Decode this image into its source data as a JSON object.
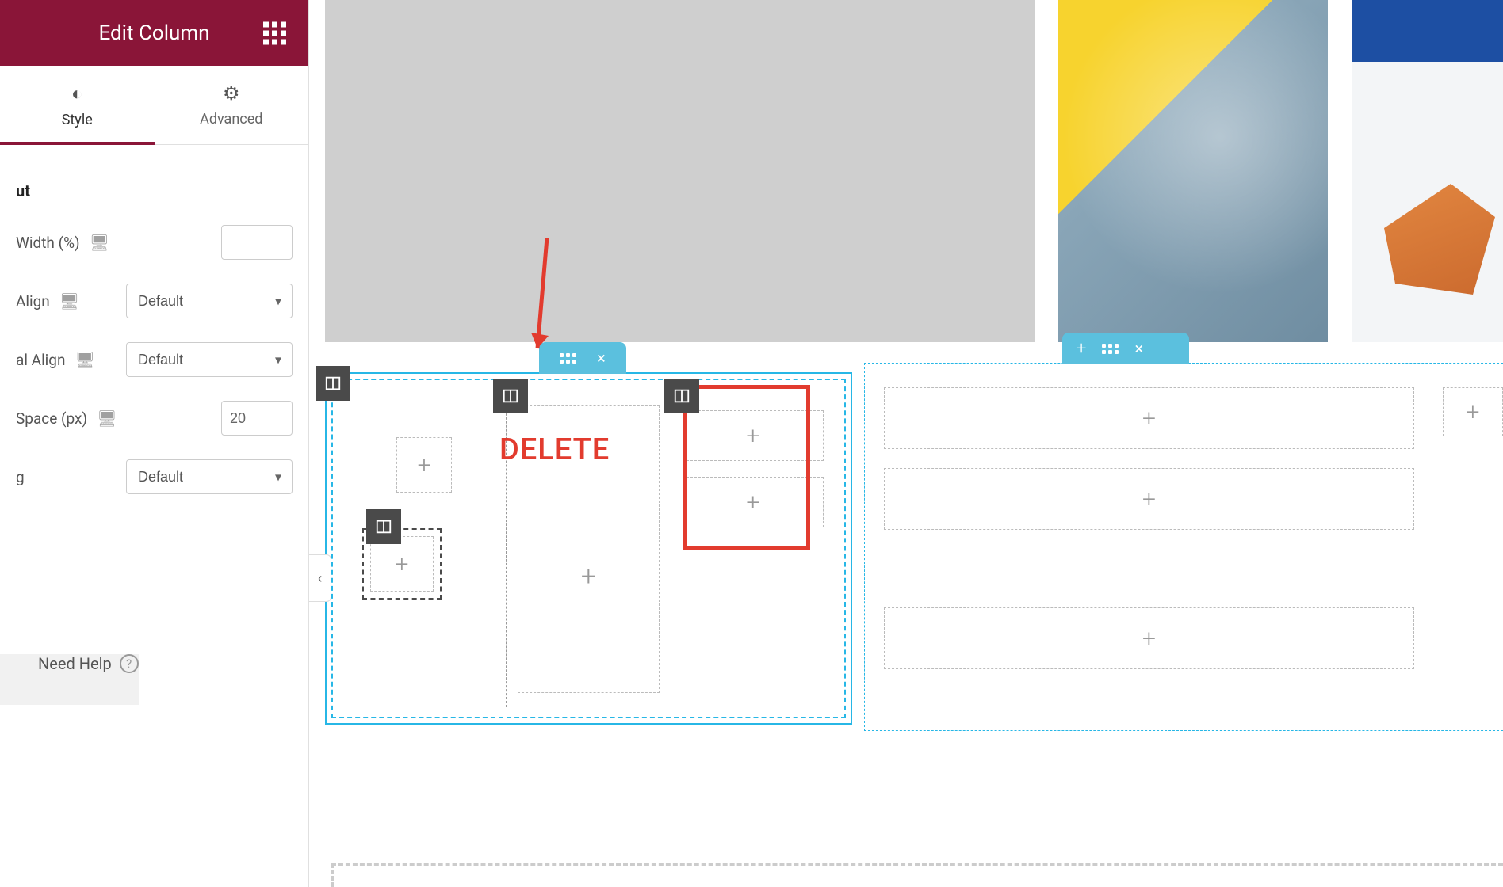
{
  "sidebar": {
    "title": "Edit Column",
    "tabs": {
      "style": "Style",
      "advanced": "Advanced"
    },
    "section": "ut",
    "controls": {
      "width_label": "Width (%)",
      "width_value": "",
      "align_label": "Align",
      "align_value": "Default",
      "valign_label": "al Align",
      "valign_value": "Default",
      "space_label": "Space (px)",
      "space_value": "20",
      "tag_label": "g",
      "tag_value": "Default"
    },
    "help": "Need Help"
  },
  "annotation": {
    "delete": "DELETE"
  },
  "icons": {
    "apps": "apps-icon",
    "style": "half-circle-icon",
    "advanced": "gear-icon",
    "desktop": "desktop-icon",
    "column": "column-icon",
    "plus": "+",
    "close": "×",
    "chevron_left": "‹",
    "help_q": "?"
  }
}
